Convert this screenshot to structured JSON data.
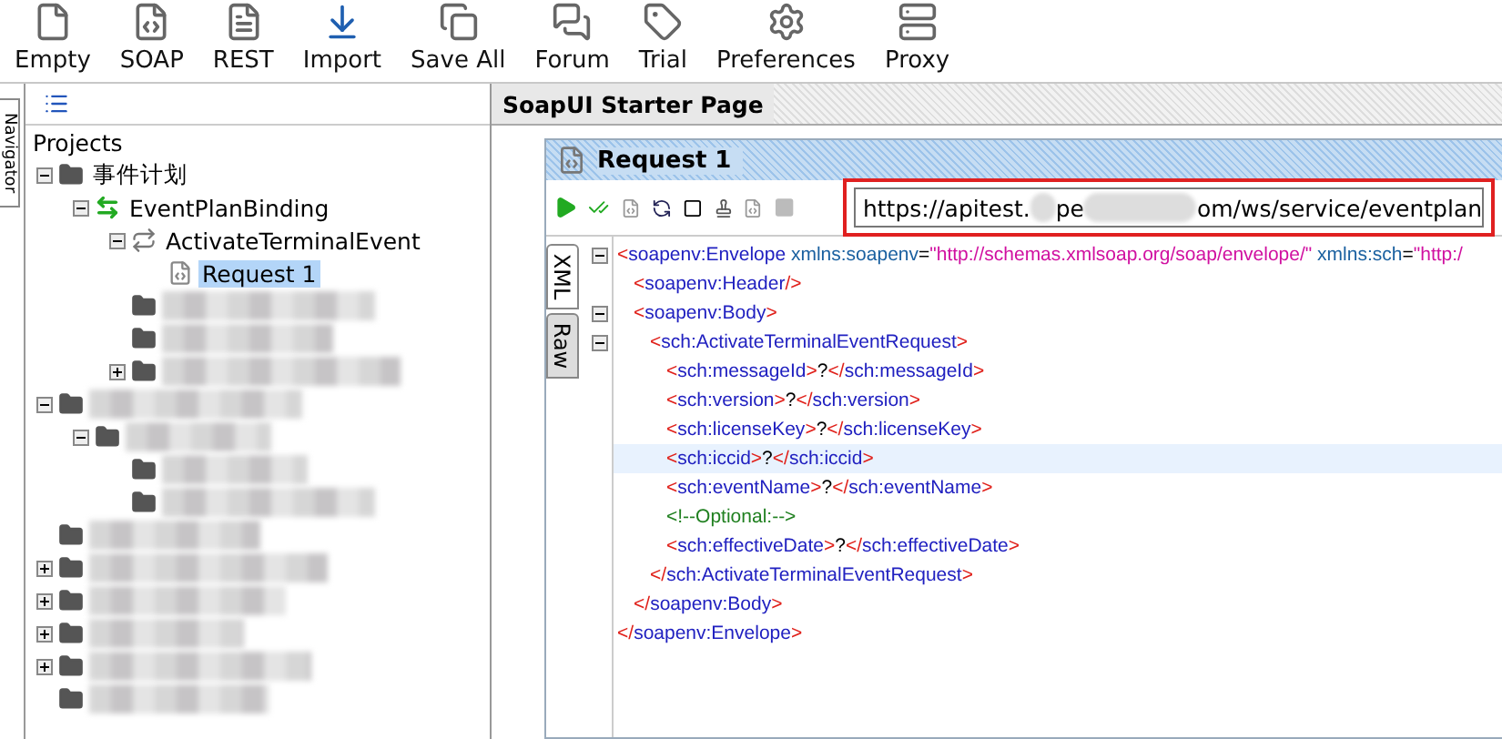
{
  "toolbar": [
    {
      "kind": "empty",
      "label": "Empty"
    },
    {
      "kind": "soap",
      "label": "SOAP"
    },
    {
      "kind": "rest",
      "label": "REST"
    },
    {
      "kind": "import",
      "label": "Import"
    },
    {
      "kind": "save-all",
      "label": "Save All"
    },
    {
      "kind": "forum",
      "label": "Forum"
    },
    {
      "kind": "trial",
      "label": "Trial"
    },
    {
      "kind": "preferences",
      "label": "Preferences"
    },
    {
      "kind": "proxy",
      "label": "Proxy"
    }
  ],
  "navigator": {
    "side_tab": "Navigator",
    "root": "Projects",
    "children": [
      {
        "kind": "project",
        "name": "事件计划",
        "selected": false,
        "expanded": true,
        "children": [
          {
            "kind": "interface",
            "name": "EventPlanBinding",
            "selected": false,
            "expanded": true,
            "children": [
              {
                "kind": "operation",
                "name": "ActivateTerminalEvent",
                "selected": false,
                "expanded": true,
                "children": [
                  {
                    "kind": "request",
                    "name": "Request 1",
                    "selected": true
                  }
                ]
              },
              {
                "kind": "redacted"
              },
              {
                "kind": "redacted"
              },
              {
                "kind": "redacted",
                "expanded": false
              }
            ]
          }
        ]
      },
      {
        "kind": "redacted",
        "expanded": true,
        "children": [
          {
            "kind": "redacted",
            "expanded": true,
            "children": [
              {
                "kind": "redacted"
              },
              {
                "kind": "redacted"
              }
            ]
          }
        ]
      },
      {
        "kind": "redacted"
      },
      {
        "kind": "redacted",
        "expanded": false
      },
      {
        "kind": "redacted",
        "expanded": false
      },
      {
        "kind": "redacted",
        "expanded": false
      },
      {
        "kind": "redacted",
        "expanded": false
      },
      {
        "kind": "redacted"
      }
    ]
  },
  "main_tab": {
    "title": "SoapUI Starter Page"
  },
  "request": {
    "title": "Request 1",
    "url_parts": [
      "https://apitest.",
      "pe",
      "om/ws/service/eventplan"
    ],
    "url_highlighted": true,
    "editor_tabs": [
      {
        "label": "XML",
        "selected": true
      },
      {
        "label": "Raw",
        "selected": false
      }
    ],
    "xml": [
      {
        "expanded": true,
        "highlighted": false,
        "tokens": [
          {
            "kind": "bracket",
            "text": "<"
          },
          {
            "kind": "tag",
            "text": "soapenv:Envelope"
          },
          {
            "kind": "attr",
            "text": " xmlns:soapenv"
          },
          {
            "kind": "equals",
            "text": "="
          },
          {
            "kind": "value",
            "text": "\"http://schemas.xmlsoap.org/soap/envelope/\""
          },
          {
            "kind": "attr",
            "text": " xmlns:sch"
          },
          {
            "kind": "equals",
            "text": "="
          },
          {
            "kind": "value",
            "text": "\"http:/"
          }
        ],
        "end_tokens": [
          {
            "kind": "bracket",
            "text": "</"
          },
          {
            "kind": "tag",
            "text": "soapenv:Envelope"
          },
          {
            "kind": "bracket",
            "text": ">"
          }
        ],
        "children": [
          {
            "highlighted": false,
            "tokens": [
              {
                "kind": "bracket",
                "text": "<"
              },
              {
                "kind": "tag",
                "text": "soapenv:Header"
              },
              {
                "kind": "bracket",
                "text": "/>"
              }
            ]
          },
          {
            "expanded": true,
            "highlighted": false,
            "tokens": [
              {
                "kind": "bracket",
                "text": "<"
              },
              {
                "kind": "tag",
                "text": "soapenv:Body"
              },
              {
                "kind": "bracket",
                "text": ">"
              }
            ],
            "end_tokens": [
              {
                "kind": "bracket",
                "text": "</"
              },
              {
                "kind": "tag",
                "text": "soapenv:Body"
              },
              {
                "kind": "bracket",
                "text": ">"
              }
            ],
            "children": [
              {
                "expanded": true,
                "highlighted": false,
                "tokens": [
                  {
                    "kind": "bracket",
                    "text": "<"
                  },
                  {
                    "kind": "tag",
                    "text": "sch:ActivateTerminalEventRequest"
                  },
                  {
                    "kind": "bracket",
                    "text": ">"
                  }
                ],
                "end_tokens": [
                  {
                    "kind": "bracket",
                    "text": "</"
                  },
                  {
                    "kind": "tag",
                    "text": "sch:ActivateTerminalEventRequest"
                  },
                  {
                    "kind": "bracket",
                    "text": ">"
                  }
                ],
                "children": [
                  {
                    "highlighted": false,
                    "tokens": [
                      {
                        "kind": "bracket",
                        "text": "<"
                      },
                      {
                        "kind": "tag",
                        "text": "sch:messageId"
                      },
                      {
                        "kind": "bracket",
                        "text": ">"
                      },
                      {
                        "kind": "text",
                        "text": "?"
                      },
                      {
                        "kind": "bracket",
                        "text": "</"
                      },
                      {
                        "kind": "tag",
                        "text": "sch:messageId"
                      },
                      {
                        "kind": "bracket",
                        "text": ">"
                      }
                    ]
                  },
                  {
                    "highlighted": false,
                    "tokens": [
                      {
                        "kind": "bracket",
                        "text": "<"
                      },
                      {
                        "kind": "tag",
                        "text": "sch:version"
                      },
                      {
                        "kind": "bracket",
                        "text": ">"
                      },
                      {
                        "kind": "text",
                        "text": "?"
                      },
                      {
                        "kind": "bracket",
                        "text": "</"
                      },
                      {
                        "kind": "tag",
                        "text": "sch:version"
                      },
                      {
                        "kind": "bracket",
                        "text": ">"
                      }
                    ]
                  },
                  {
                    "highlighted": false,
                    "tokens": [
                      {
                        "kind": "bracket",
                        "text": "<"
                      },
                      {
                        "kind": "tag",
                        "text": "sch:licenseKey"
                      },
                      {
                        "kind": "bracket",
                        "text": ">"
                      },
                      {
                        "kind": "text",
                        "text": "?"
                      },
                      {
                        "kind": "bracket",
                        "text": "</"
                      },
                      {
                        "kind": "tag",
                        "text": "sch:licenseKey"
                      },
                      {
                        "kind": "bracket",
                        "text": ">"
                      }
                    ]
                  },
                  {
                    "highlighted": true,
                    "tokens": [
                      {
                        "kind": "bracket",
                        "text": "<"
                      },
                      {
                        "kind": "tag",
                        "text": "sch:iccid"
                      },
                      {
                        "kind": "bracket",
                        "text": ">"
                      },
                      {
                        "kind": "text",
                        "text": "?"
                      },
                      {
                        "kind": "bracket",
                        "text": "</"
                      },
                      {
                        "kind": "tag",
                        "text": "sch:iccid"
                      },
                      {
                        "kind": "bracket",
                        "text": ">"
                      }
                    ]
                  },
                  {
                    "highlighted": false,
                    "tokens": [
                      {
                        "kind": "bracket",
                        "text": "<"
                      },
                      {
                        "kind": "tag",
                        "text": "sch:eventName"
                      },
                      {
                        "kind": "bracket",
                        "text": ">"
                      },
                      {
                        "kind": "text",
                        "text": "?"
                      },
                      {
                        "kind": "bracket",
                        "text": "</"
                      },
                      {
                        "kind": "tag",
                        "text": "sch:eventName"
                      },
                      {
                        "kind": "bracket",
                        "text": ">"
                      }
                    ]
                  },
                  {
                    "highlighted": false,
                    "tokens": [
                      {
                        "kind": "comment",
                        "text": "<!--Optional:-->"
                      }
                    ]
                  },
                  {
                    "highlighted": false,
                    "tokens": [
                      {
                        "kind": "bracket",
                        "text": "<"
                      },
                      {
                        "kind": "tag",
                        "text": "sch:effectiveDate"
                      },
                      {
                        "kind": "bracket",
                        "text": ">"
                      },
                      {
                        "kind": "text",
                        "text": "?"
                      },
                      {
                        "kind": "bracket",
                        "text": "</"
                      },
                      {
                        "kind": "tag",
                        "text": "sch:effectiveDate"
                      },
                      {
                        "kind": "bracket",
                        "text": ">"
                      }
                    ]
                  }
                ]
              }
            ]
          }
        ]
      }
    ]
  }
}
